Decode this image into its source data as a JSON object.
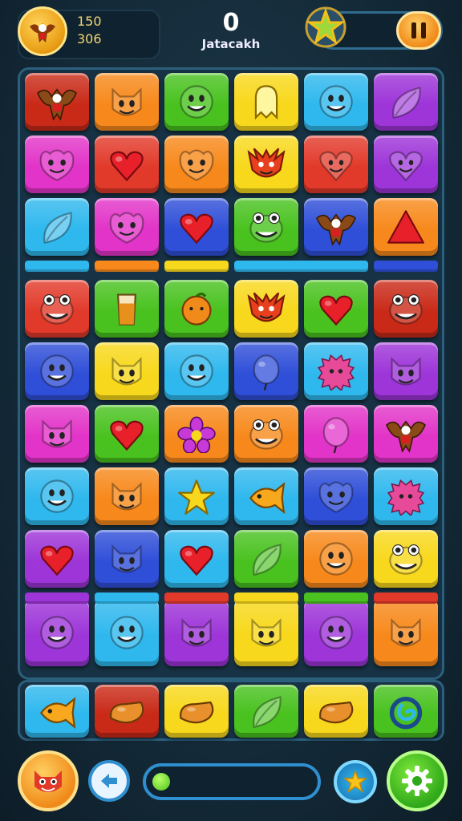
{
  "header": {
    "stat_top": "150",
    "stat_bottom": "306",
    "score": "0",
    "score_label": "Jatacakh",
    "progress_fraction": 0.08
  },
  "colors": {
    "red": "#e23a2a",
    "orange": "#f7891c",
    "green": "#49c21f",
    "yellow": "#f8d81c",
    "cyan": "#2fb8ee",
    "purple": "#9d35d8",
    "magenta": "#e234c8",
    "blue": "#2f4fd8",
    "darkred": "#c92a18"
  },
  "board": {
    "rows": [
      [
        {
          "c": "darkred",
          "i": "eagle"
        },
        {
          "c": "orange",
          "i": "cat"
        },
        {
          "c": "green",
          "i": "smile"
        },
        {
          "c": "yellow",
          "i": "ghost"
        },
        {
          "c": "cyan",
          "i": "smile"
        },
        {
          "c": "purple",
          "i": "leaf"
        }
      ],
      [
        {
          "c": "magenta",
          "i": "monster"
        },
        {
          "c": "red",
          "i": "heart"
        },
        {
          "c": "orange",
          "i": "monster"
        },
        {
          "c": "yellow",
          "i": "dragon"
        },
        {
          "c": "red",
          "i": "heart-face"
        },
        {
          "c": "purple",
          "i": "heart-face"
        }
      ],
      [
        {
          "c": "cyan",
          "i": "leaf"
        },
        {
          "c": "magenta",
          "i": "monster"
        },
        {
          "c": "blue",
          "i": "heart"
        },
        {
          "c": "green",
          "i": "frog"
        },
        {
          "c": "blue",
          "i": "eagle"
        },
        {
          "c": "orange",
          "i": "triangle"
        }
      ],
      [
        {
          "c": "red",
          "i": "frog"
        },
        {
          "c": "green",
          "i": "glass"
        },
        {
          "c": "green",
          "i": "orange"
        },
        {
          "c": "yellow",
          "i": "dragon"
        },
        {
          "c": "green",
          "i": "heart"
        },
        {
          "c": "darkred",
          "i": "frog"
        }
      ],
      [
        {
          "c": "blue",
          "i": "smile"
        },
        {
          "c": "yellow",
          "i": "cat"
        },
        {
          "c": "cyan",
          "i": "smile"
        },
        {
          "c": "blue",
          "i": "balloon"
        },
        {
          "c": "cyan",
          "i": "fuzz"
        },
        {
          "c": "purple",
          "i": "cat"
        }
      ],
      [
        {
          "c": "magenta",
          "i": "cat"
        },
        {
          "c": "green",
          "i": "heart"
        },
        {
          "c": "orange",
          "i": "flower"
        },
        {
          "c": "orange",
          "i": "frog"
        },
        {
          "c": "magenta",
          "i": "balloon"
        },
        {
          "c": "magenta",
          "i": "eagle"
        }
      ],
      [
        {
          "c": "cyan",
          "i": "smile"
        },
        {
          "c": "orange",
          "i": "cat"
        },
        {
          "c": "cyan",
          "i": "star"
        },
        {
          "c": "cyan",
          "i": "fish"
        },
        {
          "c": "blue",
          "i": "monster"
        },
        {
          "c": "cyan",
          "i": "fuzz"
        }
      ],
      [
        {
          "c": "purple",
          "i": "heart"
        },
        {
          "c": "blue",
          "i": "cat"
        },
        {
          "c": "cyan",
          "i": "heart"
        },
        {
          "c": "green",
          "i": "leaf"
        },
        {
          "c": "orange",
          "i": "smile"
        },
        {
          "c": "yellow",
          "i": "frog"
        }
      ],
      [
        {
          "c": "purple",
          "i": "smile"
        },
        {
          "c": "cyan",
          "i": "smile"
        },
        {
          "c": "purple",
          "i": "cat"
        },
        {
          "c": "yellow",
          "i": "cat"
        },
        {
          "c": "purple",
          "i": "smile"
        },
        {
          "c": "orange",
          "i": "cat"
        }
      ]
    ]
  },
  "tray": [
    {
      "c": "cyan",
      "i": "fish"
    },
    {
      "c": "darkred",
      "i": "bean"
    },
    {
      "c": "yellow",
      "i": "bean"
    },
    {
      "c": "green",
      "i": "leaf"
    },
    {
      "c": "yellow",
      "i": "bean"
    },
    {
      "c": "green",
      "i": "swirl"
    }
  ],
  "icons": {
    "avatar": "eagle-emblem-icon",
    "star": "star-icon",
    "pause": "pause-icon",
    "bottom_left": "monster-face-icon",
    "back": "back-arrow-icon",
    "star_button": "star-icon",
    "settings": "gear-icon"
  }
}
